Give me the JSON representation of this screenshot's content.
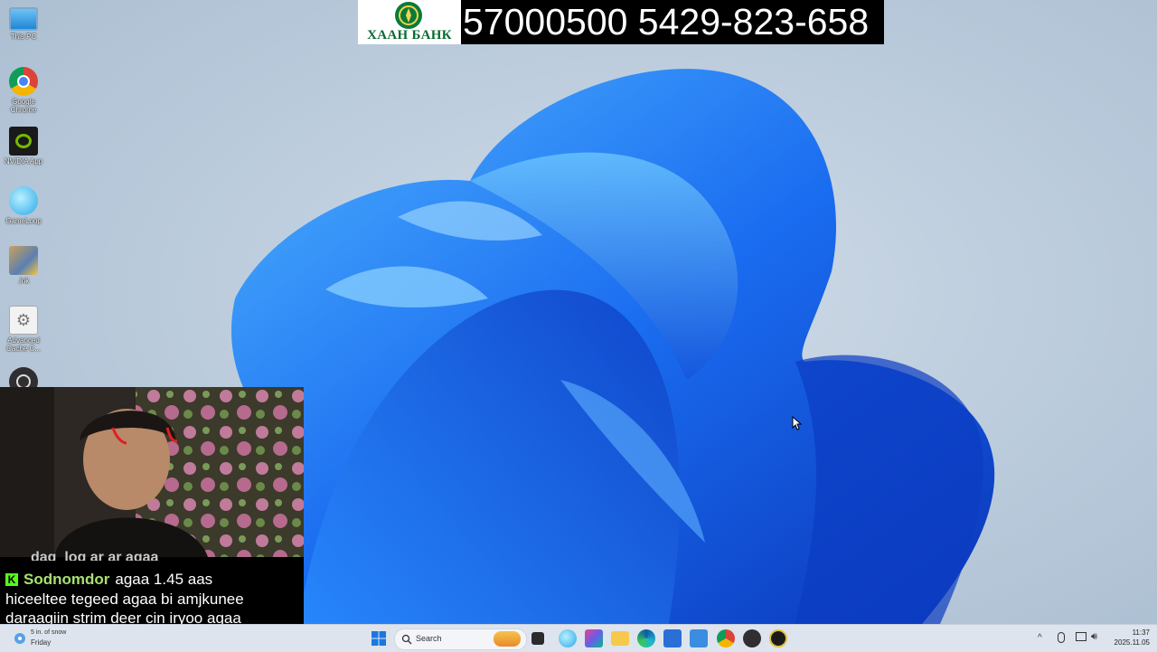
{
  "banner": {
    "bank_name": "ХААН БАНК",
    "account_text": "57000500 5429-823-658"
  },
  "desktop": {
    "icons": [
      {
        "label": "This PC",
        "icon": "monitor-icon"
      },
      {
        "label": "Google Chrome",
        "icon": "chrome-icon"
      },
      {
        "label": "NVIDIA App",
        "icon": "nvidia-icon"
      },
      {
        "label": "GameLoop",
        "icon": "gameloop-icon"
      },
      {
        "label": ".lnk",
        "icon": "pubg-icon"
      },
      {
        "label": "Advanced Cache C...",
        "icon": "gear-icon"
      },
      {
        "label": "",
        "icon": "obs-icon"
      }
    ]
  },
  "chat": {
    "previous_user": "dag_log ar ar agaa",
    "platform_icon": "kick-icon",
    "username": "Sodnomdor",
    "line1": "agaa 1.45 aas",
    "line2": "hiceeltee tegeed agaa bi amjkunee",
    "line3": "daraagiin strim deer cin iryoo agaa"
  },
  "taskbar": {
    "weather_line1": "5 in. of snow",
    "weather_day": "Friday",
    "search_placeholder": "Search",
    "clock_time": "11:37",
    "clock_date": "2025.11.05"
  },
  "colors": {
    "taskbar_bg": "#dde4ee",
    "banner_bg": "#000000",
    "bank_green": "#0b7a3b",
    "kick_green": "#53fc18"
  }
}
